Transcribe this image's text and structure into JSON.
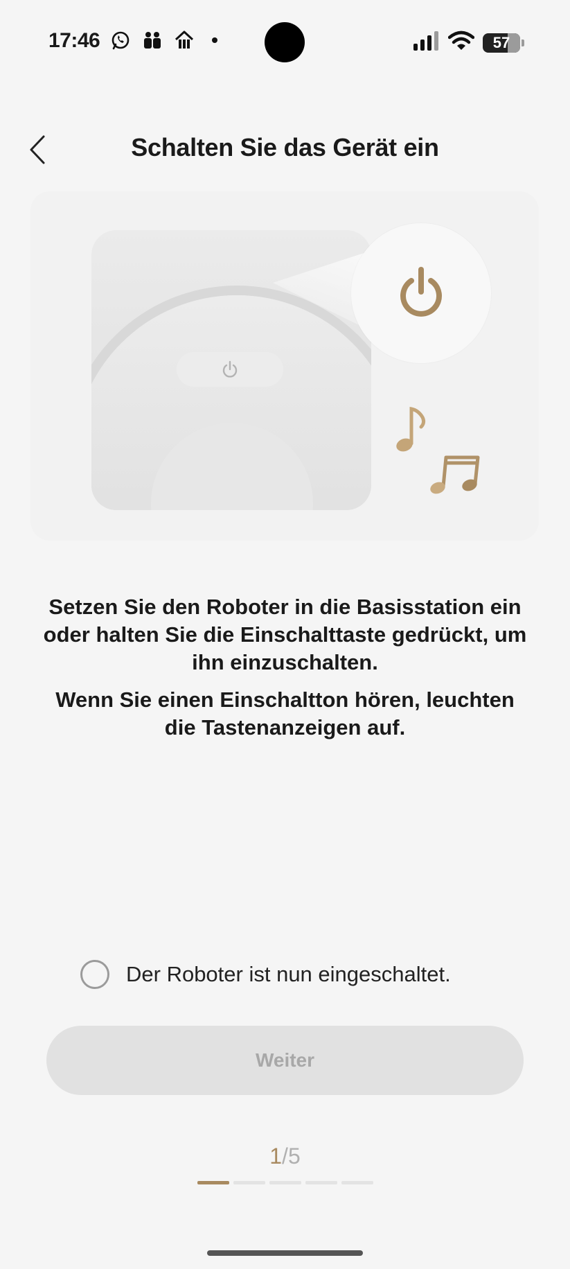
{
  "status_bar": {
    "time": "17:46",
    "battery": "57",
    "left_icons": [
      "whatsapp-icon",
      "contacts-icon",
      "lieferando-icon",
      "notification-dot"
    ],
    "right_icons": [
      "signal-icon",
      "wifi-icon",
      "battery-icon"
    ]
  },
  "header": {
    "title": "Schalten Sie das Gerät ein",
    "back_icon": "chevron-left-icon"
  },
  "illustration": {
    "icons": [
      "power-icon",
      "music-note-icon",
      "music-notes-icon"
    ],
    "accent_color": "#a88a60"
  },
  "instructions": {
    "line1": "Setzen Sie den Roboter in die Basisstation ein oder halten Sie die Einschalttaste gedrückt, um ihn einzuschalten.",
    "line2": "Wenn Sie einen Einschaltton hören, leuchten die Tastenanzeigen auf."
  },
  "confirm": {
    "label": "Der Roboter ist nun eingeschaltet.",
    "checked": false
  },
  "next_button": {
    "label": "Weiter",
    "enabled": false
  },
  "pagination": {
    "current": "1",
    "separator": "/",
    "total": "5"
  }
}
